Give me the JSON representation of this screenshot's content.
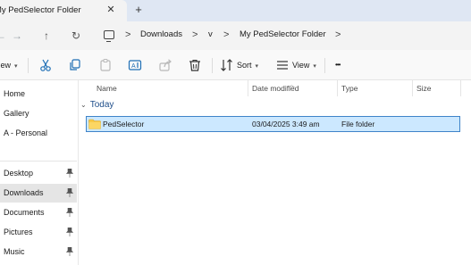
{
  "window": {
    "tab_title": "My PedSelector Folder",
    "tab_close_glyph": "✕",
    "new_tab_glyph": "+"
  },
  "nav": {
    "back_glyph": "←",
    "forward_glyph": "→",
    "up_glyph": "↑",
    "refresh_glyph": "↻"
  },
  "address": {
    "icon": "monitor-icon",
    "separator": ">",
    "crumbs": [
      "Downloads",
      "v",
      "My PedSelector Folder"
    ]
  },
  "toolbar": {
    "new_label": "New",
    "sort_label": "Sort",
    "view_label": "View",
    "more_glyph": "•••",
    "icons": [
      "cut-icon",
      "copy-icon",
      "paste-icon",
      "rename-icon",
      "share-icon",
      "delete-icon"
    ]
  },
  "sidebar": {
    "items": [
      {
        "label": "Home",
        "pinned": false
      },
      {
        "label": "Gallery",
        "pinned": false
      },
      {
        "label": "A - Personal",
        "pinned": false
      },
      {
        "label": "Desktop",
        "pinned": true
      },
      {
        "label": "Downloads",
        "pinned": true,
        "active": true
      },
      {
        "label": "Documents",
        "pinned": true
      },
      {
        "label": "Pictures",
        "pinned": true
      },
      {
        "label": "Music",
        "pinned": true
      }
    ]
  },
  "list": {
    "columns": [
      "Name",
      "Date modified",
      "Type",
      "Size"
    ],
    "group_label": "Today",
    "rows": [
      {
        "name": "PedSelector",
        "date": "03/04/2025 3:49 am",
        "type": "File folder",
        "size": ""
      }
    ]
  },
  "colors": {
    "accent_selection": "#cce8ff",
    "selection_border": "#3f83c9",
    "folder_yellow": "#f7c948"
  }
}
